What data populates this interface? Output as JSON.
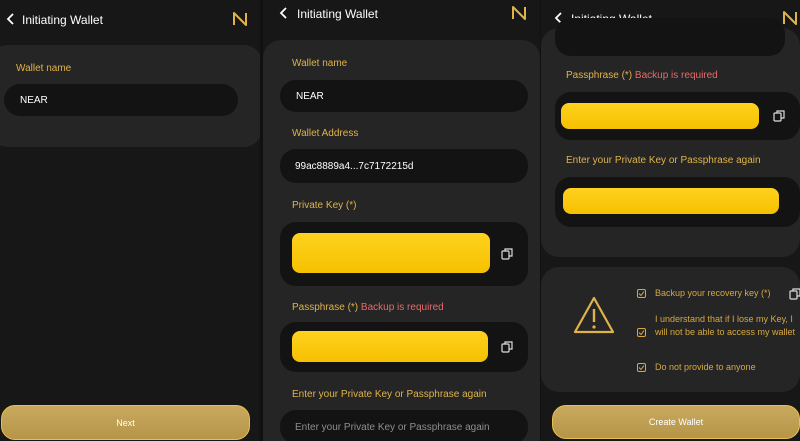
{
  "colors": {
    "accent": "#e0b34a",
    "required": "#e86a6a",
    "key_fill": "#f5c000",
    "button": "#c8a95e",
    "background": "#171717",
    "card": "#252525"
  },
  "header": {
    "title": "Initiating Wallet",
    "back_icon": "chevron-left-icon",
    "logo_icon": "near-logo-icon"
  },
  "screen1": {
    "wallet_name_label": "Wallet name",
    "wallet_name_value": "NEAR",
    "next_button": "Next"
  },
  "screen2": {
    "wallet_name_label": "Wallet name",
    "wallet_name_value": "NEAR",
    "wallet_address_label": "Wallet Address",
    "wallet_address_value": "99ac8889a4...7c7172215d",
    "private_key_label": "Private Key (*)",
    "passphrase_label": "Passphrase (*)",
    "backup_required": "Backup is required",
    "confirm_label": "Enter your Private Key or Passphrase again",
    "confirm_placeholder": "Enter your Private Key or Passphrase again"
  },
  "screen3": {
    "passphrase_label": "Passphrase (*)",
    "backup_required": "Backup is required",
    "confirm_label": "Enter your Private Key or Passphrase again",
    "checks": [
      "Backup your recovery key (*)",
      "I understand that if I lose my Key, I will not be able to access my wallet",
      "Do not provide to anyone"
    ],
    "create_button": "Create Wallet"
  }
}
